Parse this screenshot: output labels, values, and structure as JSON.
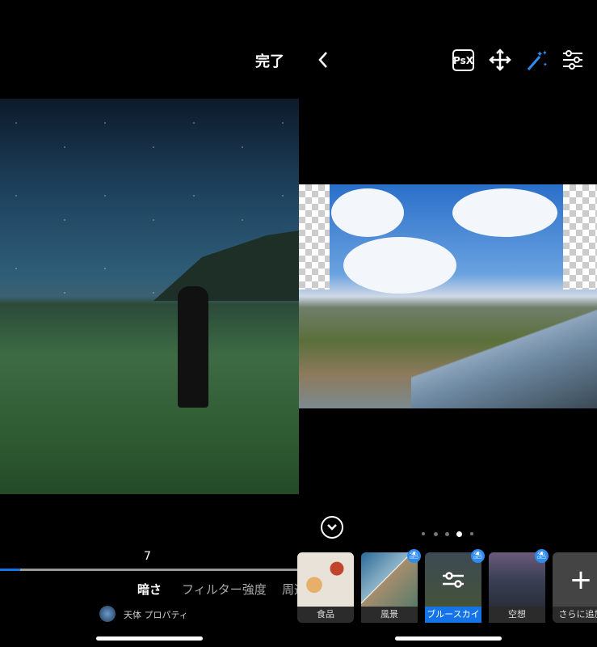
{
  "left_screen": {
    "done_label": "完了",
    "slider_value": "7",
    "slider_fraction": 0.07,
    "tabs": [
      {
        "label": "暗さ",
        "active": true
      },
      {
        "label": "フィルター強度",
        "active": false
      },
      {
        "label": "周辺",
        "active": false
      }
    ],
    "property_label": "天体 プロパティ"
  },
  "right_screen": {
    "toolbar": {
      "psx_label": "PsX",
      "icons": [
        "back-icon",
        "psx-icon",
        "move-icon",
        "magic-wand-icon",
        "sliders-icon"
      ]
    },
    "page_dots": {
      "count": 5,
      "active": 3
    },
    "presets": [
      {
        "label": "食品",
        "premium": false,
        "selected": false
      },
      {
        "label": "風景",
        "premium": true,
        "selected": false
      },
      {
        "label": "ブルースカイ",
        "premium": true,
        "selected": true
      },
      {
        "label": "空想",
        "premium": true,
        "selected": false
      },
      {
        "label": "さらに追加",
        "premium": false,
        "selected": false
      }
    ],
    "add_symbol": "+",
    "accent": "#1473e6"
  }
}
